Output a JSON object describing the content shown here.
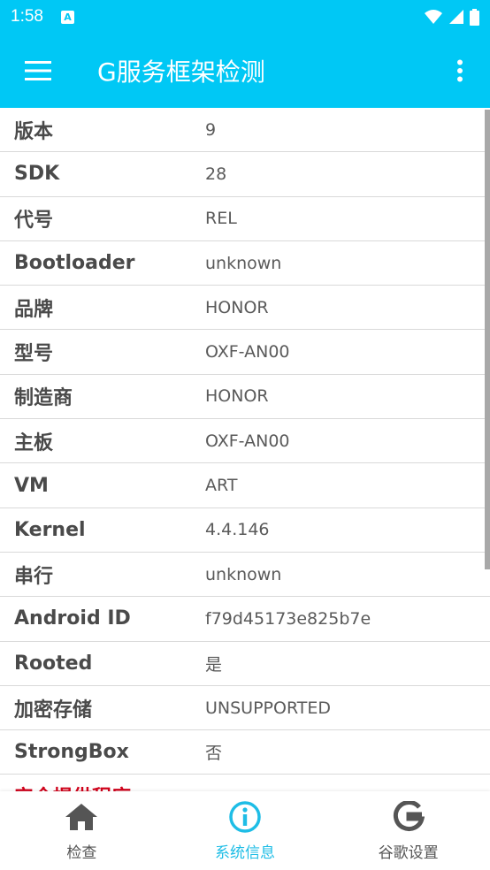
{
  "status_bar": {
    "time": "1:58",
    "notification_letter": "A"
  },
  "toolbar": {
    "title": "G服务框架检测"
  },
  "rows": [
    {
      "label": "版本",
      "value": "9"
    },
    {
      "label": "SDK",
      "value": "28"
    },
    {
      "label": "代号",
      "value": "REL"
    },
    {
      "label": "Bootloader",
      "value": "unknown"
    },
    {
      "label": "品牌",
      "value": "HONOR"
    },
    {
      "label": "型号",
      "value": "OXF-AN00"
    },
    {
      "label": "制造商",
      "value": "HONOR"
    },
    {
      "label": "主板",
      "value": "OXF-AN00"
    },
    {
      "label": "VM",
      "value": "ART"
    },
    {
      "label": "Kernel",
      "value": "4.4.146"
    },
    {
      "label": "串行",
      "value": "unknown"
    },
    {
      "label": "Android ID",
      "value": "f79d45173e825b7e"
    },
    {
      "label": "Rooted",
      "value": "是"
    },
    {
      "label": "加密存储",
      "value": "UNSUPPORTED"
    },
    {
      "label": "StrongBox",
      "value": "否"
    }
  ],
  "section_header": "安全提供程序",
  "bottom_nav": [
    {
      "label": "检查",
      "icon": "home-icon"
    },
    {
      "label": "系统信息",
      "icon": "info-icon",
      "active": true
    },
    {
      "label": "谷歌设置",
      "icon": "google-icon"
    }
  ],
  "colors": {
    "primary": "#00c8f5",
    "active_tab": "#1ebde6",
    "section_header": "#d0021b"
  }
}
